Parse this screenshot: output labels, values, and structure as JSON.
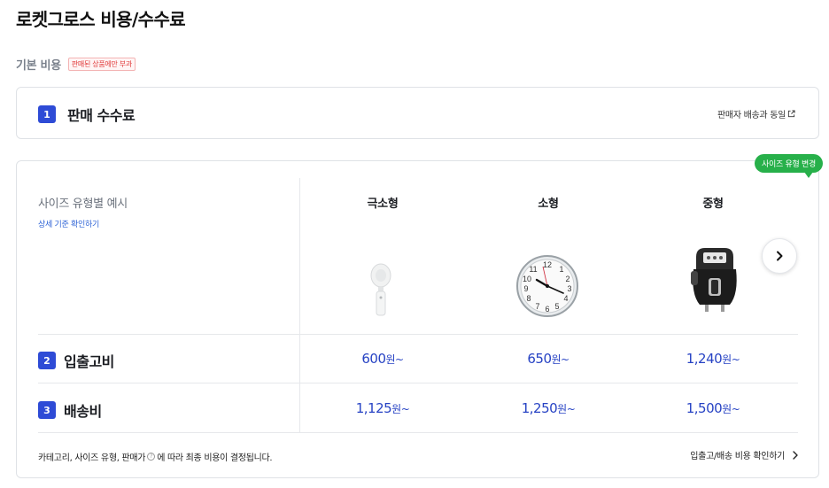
{
  "page": {
    "title": "로켓그로스 비용/수수료"
  },
  "basic_section": {
    "label": "기본 비용",
    "badge": "판매된 상품에만 부과"
  },
  "fee_card": {
    "number": "1",
    "title": "판매 수수료",
    "link_label": "판매자 배송과 동일"
  },
  "size_card": {
    "tooltip": "사이즈 유형 변경",
    "example_title": "사이즈 유형별 예시",
    "detail_link": "상세 기준 확인하기",
    "columns": [
      {
        "label": "극소형",
        "product_icon": "handheld-fan-icon"
      },
      {
        "label": "소형",
        "product_icon": "wall-clock-icon"
      },
      {
        "label": "중형",
        "product_icon": "air-fryer-icon"
      }
    ],
    "next_icon": "chevron-right-icon",
    "rows": [
      {
        "number": "2",
        "label": "입출고비",
        "prices": [
          "600",
          "650",
          "1,240"
        ]
      },
      {
        "number": "3",
        "label": "배송비",
        "prices": [
          "1,125",
          "1,250",
          "1,500"
        ]
      }
    ],
    "price_suffix": "원~",
    "note_before": "카테고리, 사이즈 유형, 판매가",
    "note_after": "에 따라 최종 비용이 결정됩니다.",
    "help_icon_glyph": "?",
    "check_link": "입출고/배송 비용 확인하기"
  }
}
